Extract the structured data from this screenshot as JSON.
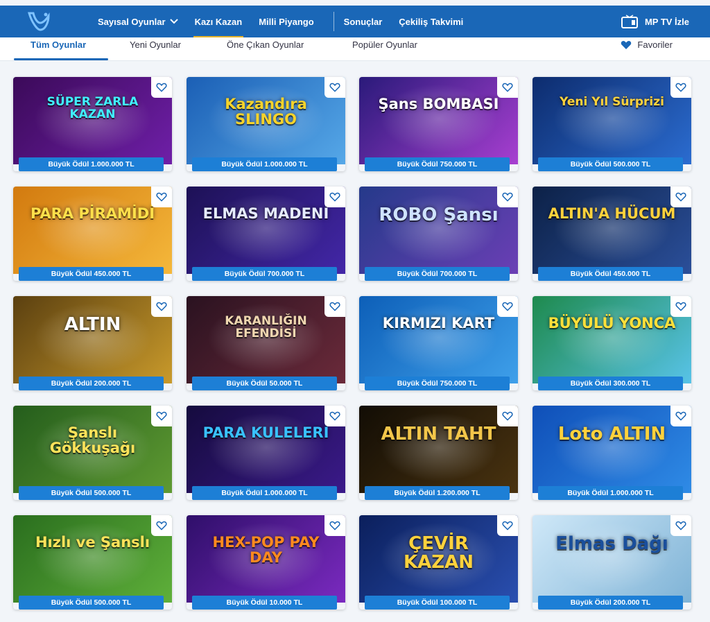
{
  "nav": {
    "items": [
      {
        "label": "Sayısal Oyunlar",
        "dropdown": true,
        "active": false
      },
      {
        "label": "Kazı Kazan",
        "dropdown": false,
        "active": true
      },
      {
        "label": "Milli Piyango",
        "dropdown": false,
        "active": false
      },
      {
        "label": "Sonuçlar",
        "dropdown": false,
        "active": false
      },
      {
        "label": "Çekiliş Takvimi",
        "dropdown": false,
        "active": false
      }
    ],
    "mptv_label": "MP TV İzle",
    "colors": {
      "bar": "#1a67b7",
      "active_underline": "#e9b52a"
    }
  },
  "subtabs": {
    "items": [
      "Tüm Oyunlar",
      "Yeni Oyunlar",
      "Öne Çıkan Oyunlar",
      "Popüler Oyunlar"
    ],
    "active_index": 0,
    "favorites_label": "Favoriler"
  },
  "games": [
    {
      "title": "SÜPER ZARLA KAZAN",
      "prize": "Büyük Ödül 1.000.000 TL",
      "bg": [
        "#3b0a59",
        "#6f1fa8"
      ],
      "fg": "#40f0ff"
    },
    {
      "title": "Kazandıra SLINGO",
      "prize": "Büyük Ödül 1.000.000 TL",
      "bg": [
        "#1b5fb5",
        "#56a8e8"
      ],
      "fg": "#f6d32a"
    },
    {
      "title": "Şans BOMBASI",
      "prize": "Büyük Ödül 750.000 TL",
      "bg": [
        "#2a1a7a",
        "#a83fd1"
      ],
      "fg": "#ffffff"
    },
    {
      "title": "Yeni Yıl Sürprizi",
      "prize": "Büyük Ödül 500.000 TL",
      "bg": [
        "#0d2c6e",
        "#2b6cd0"
      ],
      "fg": "#ffd23c"
    },
    {
      "title": "PARA PİRAMİDİ",
      "prize": "Büyük Ödül 450.000 TL",
      "bg": [
        "#d27a0f",
        "#f5b83b"
      ],
      "fg": "#ffe04b"
    },
    {
      "title": "ELMAS MADENİ",
      "prize": "Büyük Ödül 700.000 TL",
      "bg": [
        "#1d1156",
        "#4327a8"
      ],
      "fg": "#e6ecff"
    },
    {
      "title": "ROBO Şansı",
      "prize": "Büyük Ödül 700.000 TL",
      "bg": [
        "#253a8a",
        "#6b3fb5"
      ],
      "fg": "#cfe3ff"
    },
    {
      "title": "ALTIN'A HÜCUM",
      "prize": "Büyük Ödül 450.000 TL",
      "bg": [
        "#0c2147",
        "#2b4f9a"
      ],
      "fg": "#ffd23c"
    },
    {
      "title": "ALTIN",
      "prize": "Büyük Ödül 200.000 TL",
      "bg": [
        "#5b4010",
        "#c99a2b"
      ],
      "fg": "#ffffff"
    },
    {
      "title": "KARANLIĞIN EFENDİSİ",
      "prize": "Büyük Ödül 50.000 TL",
      "bg": [
        "#2a1220",
        "#6b2a3a"
      ],
      "fg": "#f0d7b0"
    },
    {
      "title": "KIRMIZI KART",
      "prize": "Büyük Ödül 750.000 TL",
      "bg": [
        "#0d5fb8",
        "#3fa0ea"
      ],
      "fg": "#ffffff"
    },
    {
      "title": "BÜYÜLÜ YONCA",
      "prize": "Büyük Ödül 300.000 TL",
      "bg": [
        "#1e8a4d",
        "#58c3e8"
      ],
      "fg": "#ffe03a"
    },
    {
      "title": "Şanslı Gökkuşağı",
      "prize": "Büyük Ödül 500.000 TL",
      "bg": [
        "#245d1c",
        "#5f9a32"
      ],
      "fg": "#ffe35a"
    },
    {
      "title": "PARA KULELERİ",
      "prize": "Büyük Ödül 1.000.000 TL",
      "bg": [
        "#150b3e",
        "#3b1a8a"
      ],
      "fg": "#39c1ff"
    },
    {
      "title": "ALTIN TAHT",
      "prize": "Büyük Ödül 1.200.000 TL",
      "bg": [
        "#120d05",
        "#4a3310"
      ],
      "fg": "#f3c64a"
    },
    {
      "title": "Loto ALTIN",
      "prize": "Büyük Ödül 1.000.000 TL",
      "bg": [
        "#0f4fb8",
        "#2f8be6"
      ],
      "fg": "#ffd23c"
    },
    {
      "title": "Hızlı ve Şanslı",
      "prize": "Büyük Ödül 500.000 TL",
      "bg": [
        "#2a6e1e",
        "#5fb03a"
      ],
      "fg": "#ffe35a"
    },
    {
      "title": "HEX-POP PAY DAY",
      "prize": "Büyük Ödül 10.000 TL",
      "bg": [
        "#2f0f6a",
        "#7b2ac0"
      ],
      "fg": "#ff8a1e"
    },
    {
      "title": "ÇEVİR KAZAN",
      "prize": "Büyük Ödül 100.000 TL",
      "bg": [
        "#0b1f5c",
        "#2a4fb0"
      ],
      "fg": "#ffd23c"
    },
    {
      "title": "Elmas Dağı",
      "prize": "Büyük Ödül 200.000 TL",
      "bg": [
        "#cfe8f8",
        "#7fb3d6"
      ],
      "fg": "#1a4f9c"
    }
  ]
}
